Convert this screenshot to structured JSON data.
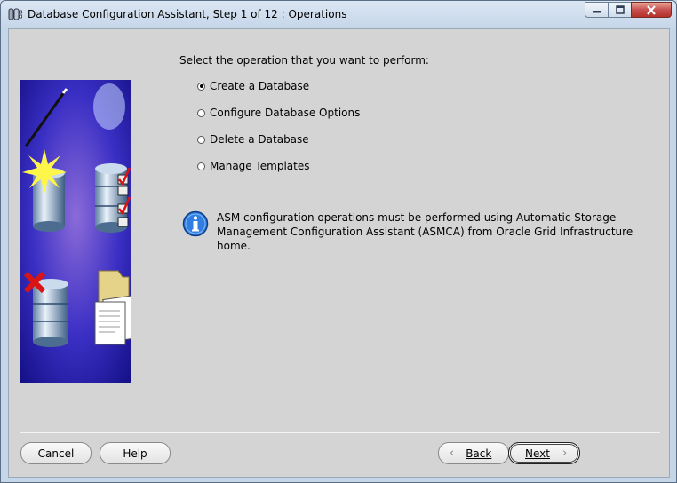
{
  "window": {
    "title": "Database Configuration Assistant, Step 1 of 12 : Operations",
    "controls": {
      "minimize_icon": "minimize-icon",
      "maximize_icon": "maximize-icon",
      "close_icon": "close-icon"
    }
  },
  "main": {
    "prompt": "Select the operation that you want to perform:",
    "options": [
      {
        "label": "Create a Database",
        "selected": true
      },
      {
        "label": "Configure Database Options",
        "selected": false
      },
      {
        "label": "Delete a Database",
        "selected": false
      },
      {
        "label": "Manage Templates",
        "selected": false
      }
    ],
    "info": {
      "icon": "info-icon",
      "text": "ASM configuration operations must be performed using Automatic Storage Management Configuration Assistant (ASMCA) from Oracle Grid Infrastructure home."
    }
  },
  "buttons": {
    "cancel": "Cancel",
    "help": "Help",
    "back": "Back",
    "next": "Next"
  },
  "colors": {
    "accent_blue": "#1a5fb4",
    "graphic_bg": "#1d1a9a"
  }
}
